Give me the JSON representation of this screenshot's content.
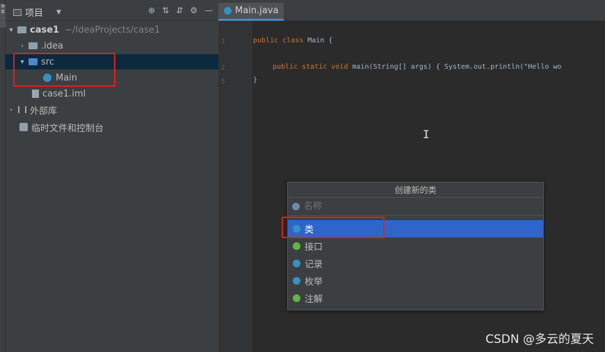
{
  "stripe": {
    "label": "项目"
  },
  "project_panel": {
    "title": "项目",
    "tools": {
      "locate": "⊕",
      "expand": "⇅",
      "collapse": "⇵",
      "settings": "⚙",
      "hide": "—"
    },
    "tree": [
      {
        "label": "case1",
        "sub": "~/IdeaProjects/case1"
      },
      {
        "label": ".idea"
      },
      {
        "label": "src"
      },
      {
        "label": "Main"
      },
      {
        "label": "case1.iml"
      },
      {
        "label": "外部库"
      },
      {
        "label": "临时文件和控制台"
      }
    ]
  },
  "editor": {
    "tab_label": "Main.java",
    "line_numbers": [
      "1",
      "2",
      "5"
    ],
    "lines": [
      {
        "kw": "public class",
        "text": " Main {"
      },
      {
        "kw": "public static void",
        "text": " main(String[] args) { System.out.println(\"Hello wo"
      },
      {
        "kw": "",
        "text": "}"
      }
    ]
  },
  "popup": {
    "title": "创建新的类",
    "name_placeholder": "名称",
    "kinds": [
      {
        "label": "类",
        "color": "#3592c4"
      },
      {
        "label": "接口",
        "color": "#62b543"
      },
      {
        "label": "记录",
        "color": "#3592c4"
      },
      {
        "label": "枚举",
        "color": "#3592c4"
      },
      {
        "label": "注解",
        "color": "#62b543"
      }
    ]
  },
  "watermark": "CSDN @多云的夏天",
  "accent": {
    "highlight_red": "#e0201e",
    "selection_blue": "#2f65ca"
  }
}
